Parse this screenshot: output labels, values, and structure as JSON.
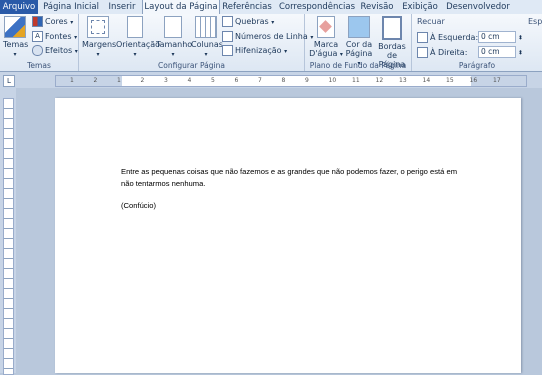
{
  "tabs": [
    "Arquivo",
    "Página Inicial",
    "Inserir",
    "Layout da Página",
    "Referências",
    "Correspondências",
    "Revisão",
    "Exibição",
    "Desenvolvedor"
  ],
  "ribbon": {
    "temas": {
      "label": "Temas",
      "temas_btn": "Temas",
      "cores": "Cores",
      "fontes": "Fontes",
      "efeitos": "Efeitos"
    },
    "configurar": {
      "label": "Configurar Página",
      "margens": "Margens",
      "orientacao": "Orientação",
      "tamanho": "Tamanho",
      "colunas": "Colunas",
      "quebras": "Quebras",
      "numeros": "Números de Linha",
      "hifenizacao": "Hifenização"
    },
    "plano": {
      "label": "Plano de Fundo da Página",
      "marca_1": "Marca",
      "marca_2": "D'água",
      "cor_1": "Cor da",
      "cor_2": "Página",
      "bordas_1": "Bordas",
      "bordas_2": "de Página"
    },
    "paragrafo": {
      "label": "Parágrafo",
      "recuar": "Recuar",
      "esquerda": "À Esquerda:",
      "direita": "À Direita:",
      "esquerda_val": "0 cm",
      "direita_val": "0 cm",
      "espa": "Espa"
    }
  },
  "ruler": {
    "numbers": [
      "1",
      "2",
      "1",
      "2",
      "3",
      "4",
      "5",
      "6",
      "7",
      "8",
      "9",
      "10",
      "11",
      "12",
      "13",
      "14",
      "15",
      "16",
      "17"
    ]
  },
  "document": {
    "paragraph1": "Entre as pequenas coisas que não fazemos e as grandes que não podemos fazer, o perigo está em não tentarmos nenhuma.",
    "paragraph2": "(Confúcio)"
  }
}
